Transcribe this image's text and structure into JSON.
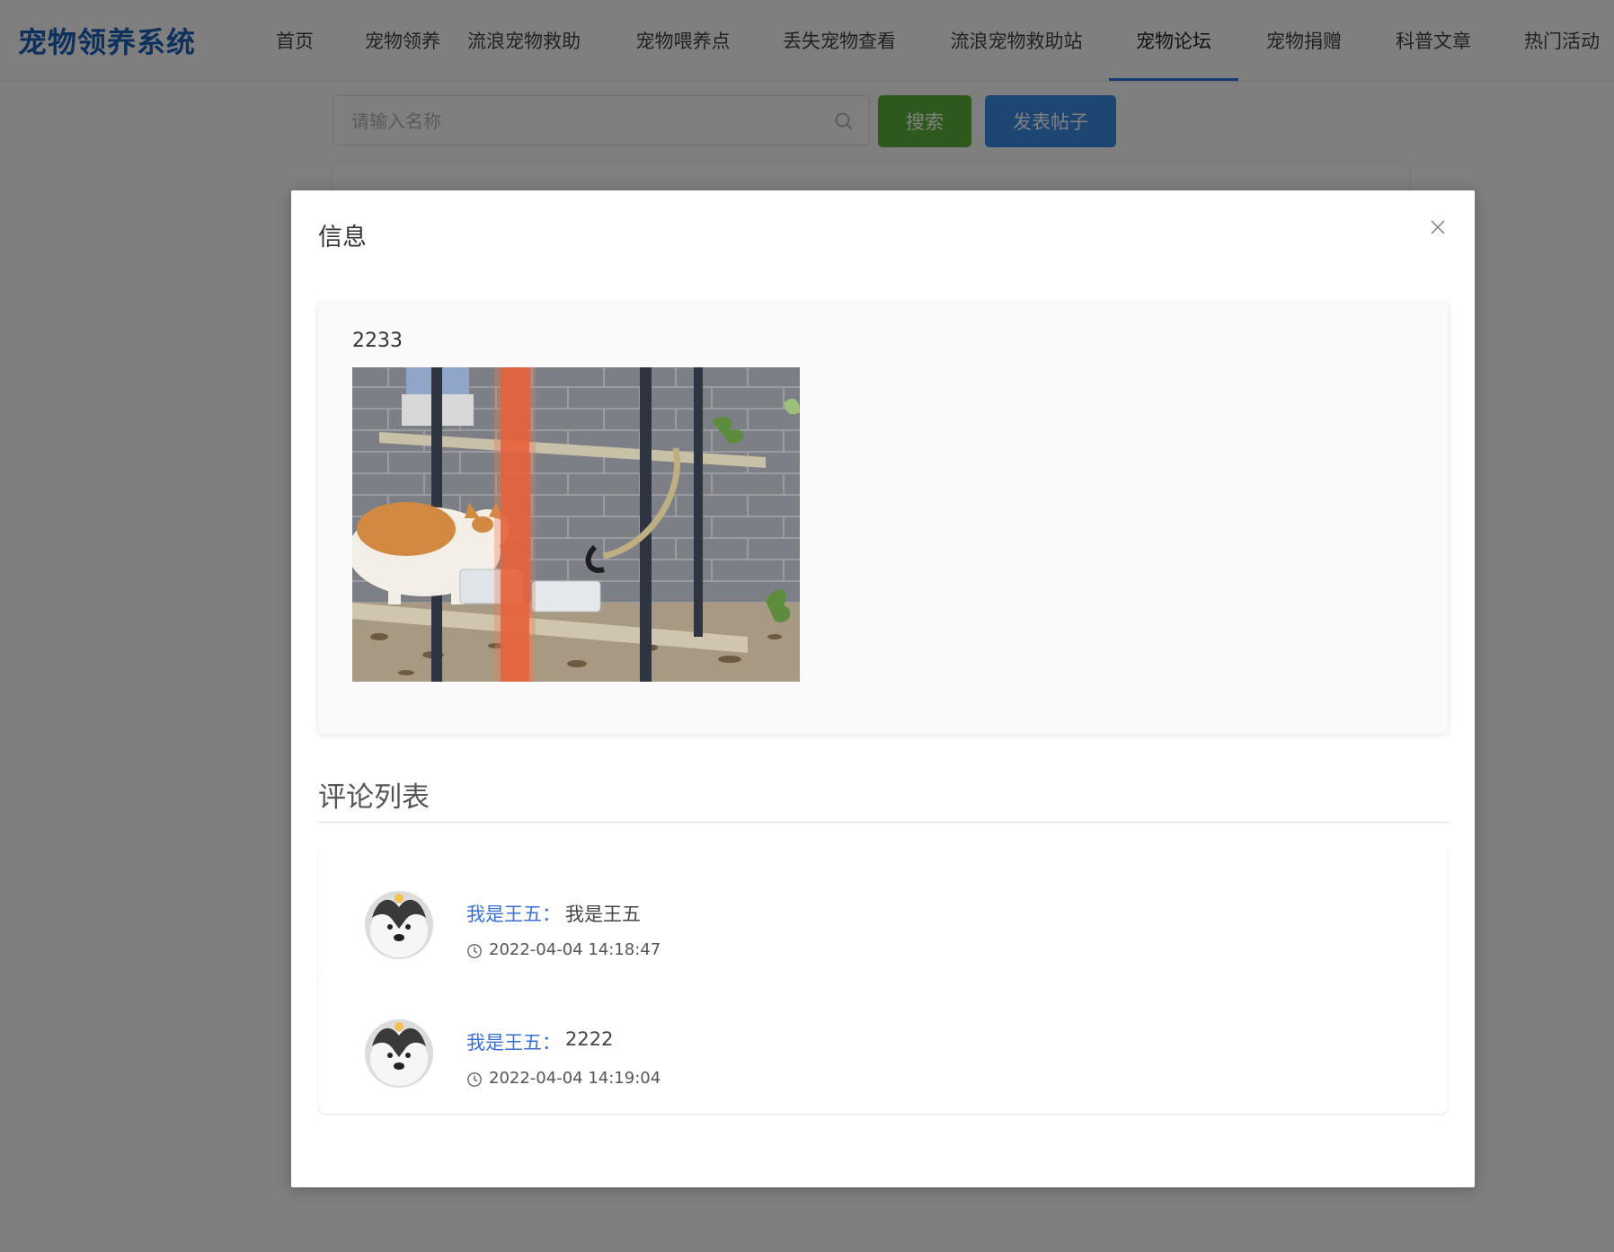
{
  "app": {
    "brand": "宠物领养系统"
  },
  "nav": {
    "items": [
      {
        "label": "首页"
      },
      {
        "label": "宠物领养"
      },
      {
        "label": "流浪宠物救助"
      },
      {
        "label": "宠物喂养点"
      },
      {
        "label": "丢失宠物查看"
      },
      {
        "label": "流浪宠物救助站"
      },
      {
        "label": "宠物论坛",
        "active": true
      },
      {
        "label": "宠物捐赠"
      },
      {
        "label": "科普文章"
      },
      {
        "label": "热门活动"
      }
    ]
  },
  "search": {
    "placeholder": "请输入名称",
    "value": "",
    "search_button": "搜索",
    "post_button": "发表帖子"
  },
  "modal": {
    "title": "信息",
    "post": {
      "text": "2233",
      "image": "cat drinking water under metal shelf"
    },
    "comments_title": "评论列表",
    "comments": [
      {
        "author": "我是王五",
        "separator": "：",
        "text": "我是王五",
        "time": "2022-04-04 14:18:47"
      },
      {
        "author": "我是王五",
        "separator": "：",
        "text": "2222",
        "time": "2022-04-04 14:19:04"
      }
    ]
  },
  "icons": {
    "search": "search-icon",
    "close": "close-icon",
    "clock": "clock-icon",
    "avatar": "avatar"
  },
  "colors": {
    "brand": "#1b60b8",
    "search_button": "#5cb338",
    "post_button": "#3c8de6",
    "author_link": "#3a6fd8",
    "active_underline": "#2d7be0"
  }
}
